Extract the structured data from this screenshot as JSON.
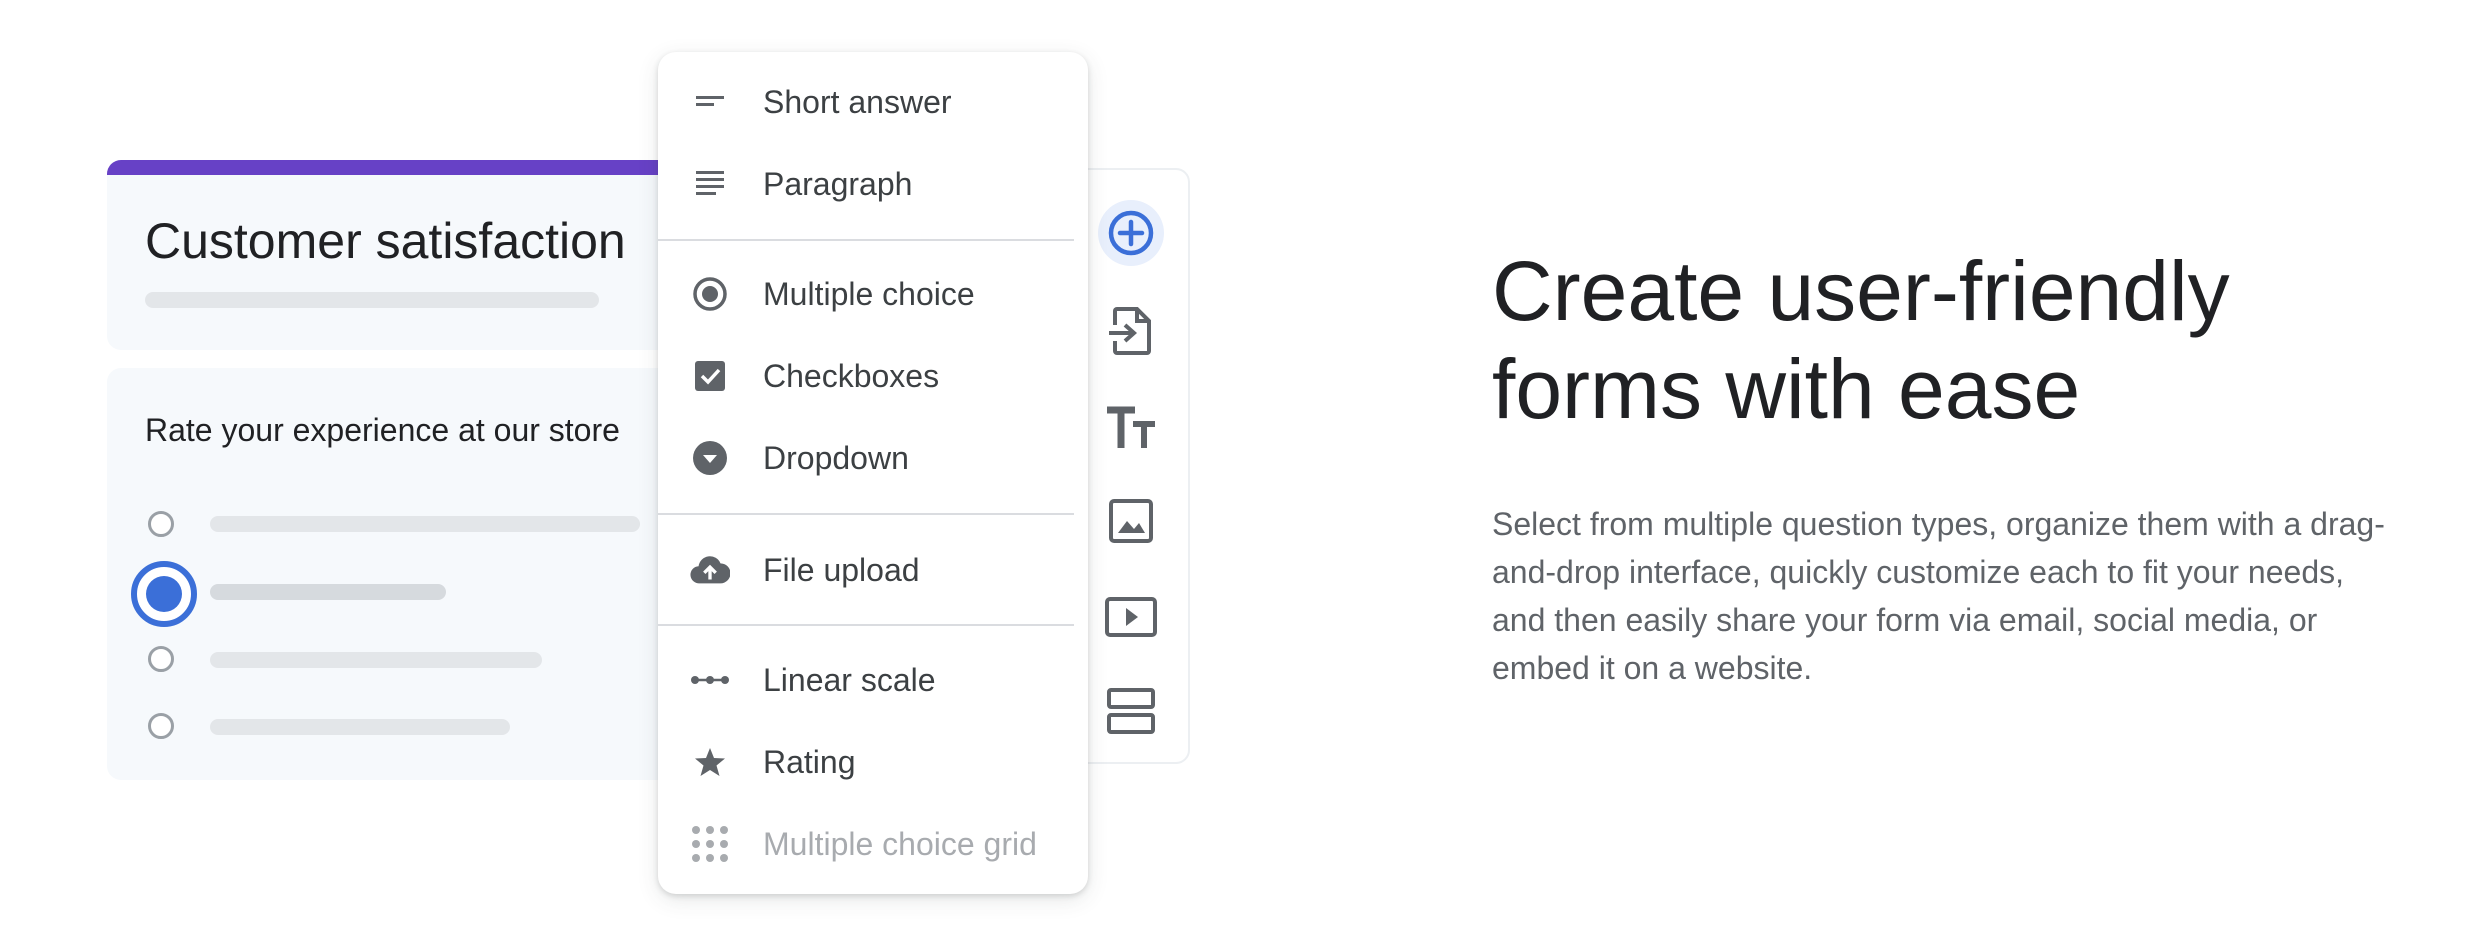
{
  "form_preview": {
    "title": "Customer satisfaction",
    "question": "Rate your experience at our store",
    "selected_option_index": 1
  },
  "question_type_menu": {
    "items": [
      {
        "label": "Short answer",
        "icon": "short-answer-icon"
      },
      {
        "label": "Paragraph",
        "icon": "paragraph-icon"
      },
      {
        "label": "Multiple choice",
        "icon": "radio-button-icon"
      },
      {
        "label": "Checkboxes",
        "icon": "checkbox-icon"
      },
      {
        "label": "Dropdown",
        "icon": "dropdown-icon"
      },
      {
        "label": "File upload",
        "icon": "cloud-upload-icon"
      },
      {
        "label": "Linear scale",
        "icon": "linear-scale-icon"
      },
      {
        "label": "Rating",
        "icon": "star-icon"
      },
      {
        "label": "Multiple choice grid",
        "icon": "grid-icon"
      }
    ]
  },
  "side_toolbar": {
    "tools": [
      "add-question-icon",
      "import-questions-icon",
      "add-title-icon",
      "add-image-icon",
      "add-video-icon",
      "add-section-icon"
    ]
  },
  "marketing": {
    "headline": "Create user-friendly forms with ease",
    "body": "Select from multiple question types, organize them with a drag-and-drop interface, quickly customize each to fit your needs, and then easily share your form via email, social media, or embed it on a website."
  },
  "colors": {
    "form_accent": "#6741c6",
    "selection_blue": "#3b6fd8",
    "card_background": "#f6f9fc"
  }
}
